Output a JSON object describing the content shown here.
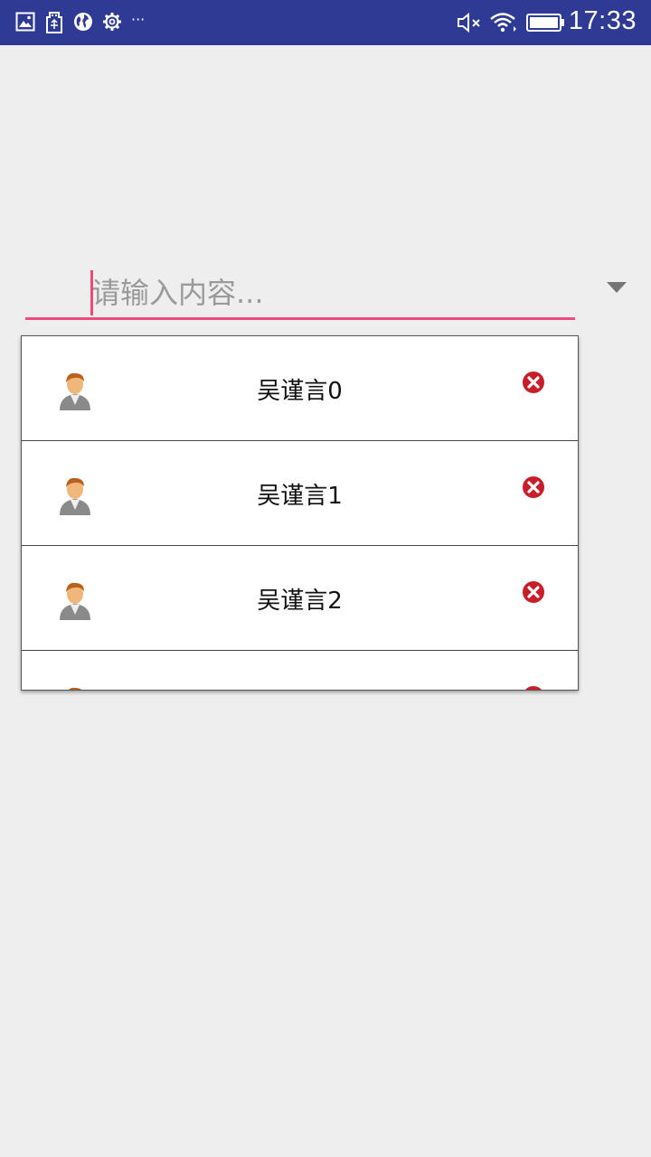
{
  "status_bar": {
    "time": "17:33",
    "overflow": "···",
    "icons": [
      "image-icon",
      "usb-icon",
      "globe-icon",
      "gear-icon",
      "mute-icon",
      "wifi-icon",
      "battery-icon"
    ]
  },
  "search": {
    "placeholder": "请输入内容...",
    "value": "",
    "accent_color": "#ee4a7e"
  },
  "dropdown": {
    "items": [
      {
        "label": "吴谨言0"
      },
      {
        "label": "吴谨言1"
      },
      {
        "label": "吴谨言2"
      },
      {
        "label": ""
      }
    ]
  },
  "colors": {
    "status_bar": "#2f3a94",
    "background": "#eeeeee",
    "delete_icon": "#c81e2a"
  }
}
